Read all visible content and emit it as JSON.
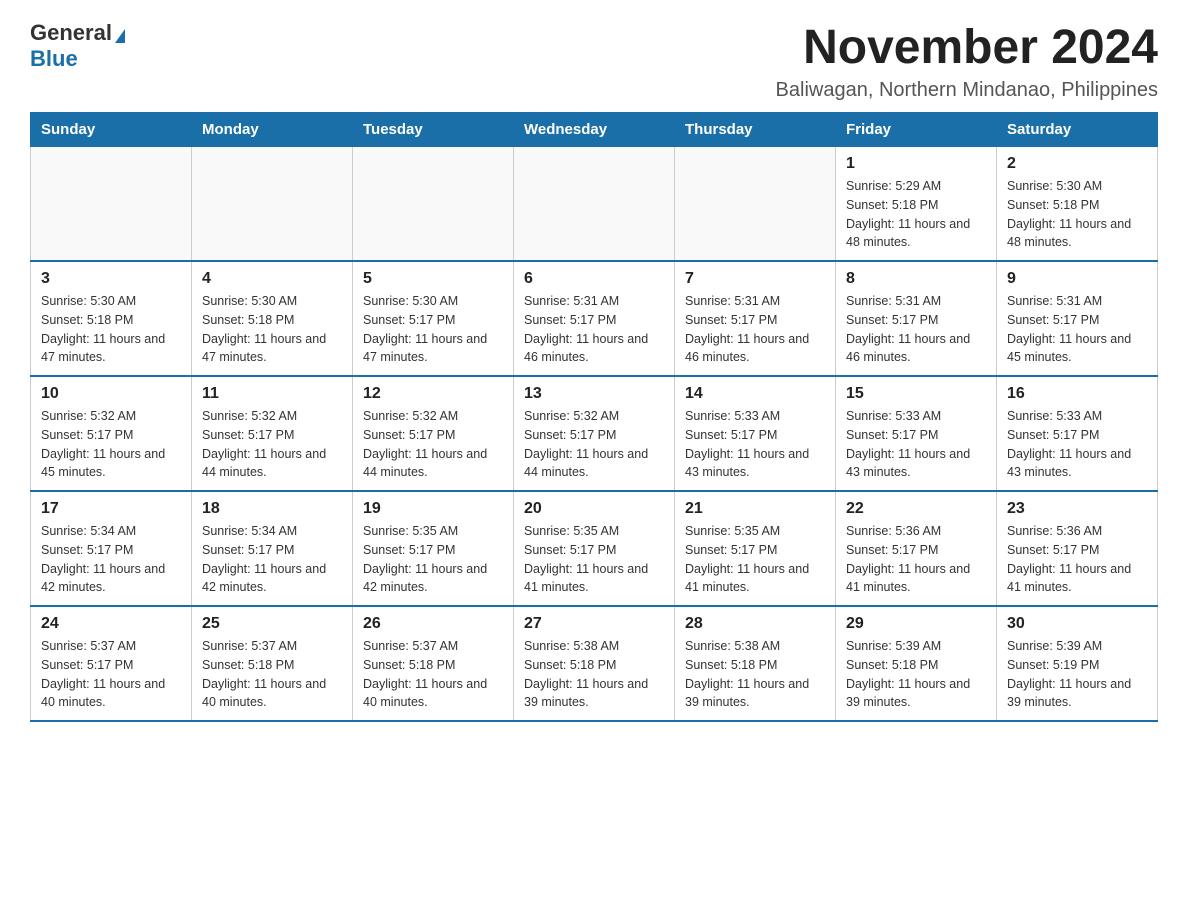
{
  "logo": {
    "general": "General",
    "blue": "Blue"
  },
  "title": "November 2024",
  "subtitle": "Baliwagan, Northern Mindanao, Philippines",
  "days_of_week": [
    "Sunday",
    "Monday",
    "Tuesday",
    "Wednesday",
    "Thursday",
    "Friday",
    "Saturday"
  ],
  "weeks": [
    [
      {
        "day": "",
        "info": ""
      },
      {
        "day": "",
        "info": ""
      },
      {
        "day": "",
        "info": ""
      },
      {
        "day": "",
        "info": ""
      },
      {
        "day": "",
        "info": ""
      },
      {
        "day": "1",
        "info": "Sunrise: 5:29 AM\nSunset: 5:18 PM\nDaylight: 11 hours and 48 minutes."
      },
      {
        "day": "2",
        "info": "Sunrise: 5:30 AM\nSunset: 5:18 PM\nDaylight: 11 hours and 48 minutes."
      }
    ],
    [
      {
        "day": "3",
        "info": "Sunrise: 5:30 AM\nSunset: 5:18 PM\nDaylight: 11 hours and 47 minutes."
      },
      {
        "day": "4",
        "info": "Sunrise: 5:30 AM\nSunset: 5:18 PM\nDaylight: 11 hours and 47 minutes."
      },
      {
        "day": "5",
        "info": "Sunrise: 5:30 AM\nSunset: 5:17 PM\nDaylight: 11 hours and 47 minutes."
      },
      {
        "day": "6",
        "info": "Sunrise: 5:31 AM\nSunset: 5:17 PM\nDaylight: 11 hours and 46 minutes."
      },
      {
        "day": "7",
        "info": "Sunrise: 5:31 AM\nSunset: 5:17 PM\nDaylight: 11 hours and 46 minutes."
      },
      {
        "day": "8",
        "info": "Sunrise: 5:31 AM\nSunset: 5:17 PM\nDaylight: 11 hours and 46 minutes."
      },
      {
        "day": "9",
        "info": "Sunrise: 5:31 AM\nSunset: 5:17 PM\nDaylight: 11 hours and 45 minutes."
      }
    ],
    [
      {
        "day": "10",
        "info": "Sunrise: 5:32 AM\nSunset: 5:17 PM\nDaylight: 11 hours and 45 minutes."
      },
      {
        "day": "11",
        "info": "Sunrise: 5:32 AM\nSunset: 5:17 PM\nDaylight: 11 hours and 44 minutes."
      },
      {
        "day": "12",
        "info": "Sunrise: 5:32 AM\nSunset: 5:17 PM\nDaylight: 11 hours and 44 minutes."
      },
      {
        "day": "13",
        "info": "Sunrise: 5:32 AM\nSunset: 5:17 PM\nDaylight: 11 hours and 44 minutes."
      },
      {
        "day": "14",
        "info": "Sunrise: 5:33 AM\nSunset: 5:17 PM\nDaylight: 11 hours and 43 minutes."
      },
      {
        "day": "15",
        "info": "Sunrise: 5:33 AM\nSunset: 5:17 PM\nDaylight: 11 hours and 43 minutes."
      },
      {
        "day": "16",
        "info": "Sunrise: 5:33 AM\nSunset: 5:17 PM\nDaylight: 11 hours and 43 minutes."
      }
    ],
    [
      {
        "day": "17",
        "info": "Sunrise: 5:34 AM\nSunset: 5:17 PM\nDaylight: 11 hours and 42 minutes."
      },
      {
        "day": "18",
        "info": "Sunrise: 5:34 AM\nSunset: 5:17 PM\nDaylight: 11 hours and 42 minutes."
      },
      {
        "day": "19",
        "info": "Sunrise: 5:35 AM\nSunset: 5:17 PM\nDaylight: 11 hours and 42 minutes."
      },
      {
        "day": "20",
        "info": "Sunrise: 5:35 AM\nSunset: 5:17 PM\nDaylight: 11 hours and 41 minutes."
      },
      {
        "day": "21",
        "info": "Sunrise: 5:35 AM\nSunset: 5:17 PM\nDaylight: 11 hours and 41 minutes."
      },
      {
        "day": "22",
        "info": "Sunrise: 5:36 AM\nSunset: 5:17 PM\nDaylight: 11 hours and 41 minutes."
      },
      {
        "day": "23",
        "info": "Sunrise: 5:36 AM\nSunset: 5:17 PM\nDaylight: 11 hours and 41 minutes."
      }
    ],
    [
      {
        "day": "24",
        "info": "Sunrise: 5:37 AM\nSunset: 5:17 PM\nDaylight: 11 hours and 40 minutes."
      },
      {
        "day": "25",
        "info": "Sunrise: 5:37 AM\nSunset: 5:18 PM\nDaylight: 11 hours and 40 minutes."
      },
      {
        "day": "26",
        "info": "Sunrise: 5:37 AM\nSunset: 5:18 PM\nDaylight: 11 hours and 40 minutes."
      },
      {
        "day": "27",
        "info": "Sunrise: 5:38 AM\nSunset: 5:18 PM\nDaylight: 11 hours and 39 minutes."
      },
      {
        "day": "28",
        "info": "Sunrise: 5:38 AM\nSunset: 5:18 PM\nDaylight: 11 hours and 39 minutes."
      },
      {
        "day": "29",
        "info": "Sunrise: 5:39 AM\nSunset: 5:18 PM\nDaylight: 11 hours and 39 minutes."
      },
      {
        "day": "30",
        "info": "Sunrise: 5:39 AM\nSunset: 5:19 PM\nDaylight: 11 hours and 39 minutes."
      }
    ]
  ]
}
